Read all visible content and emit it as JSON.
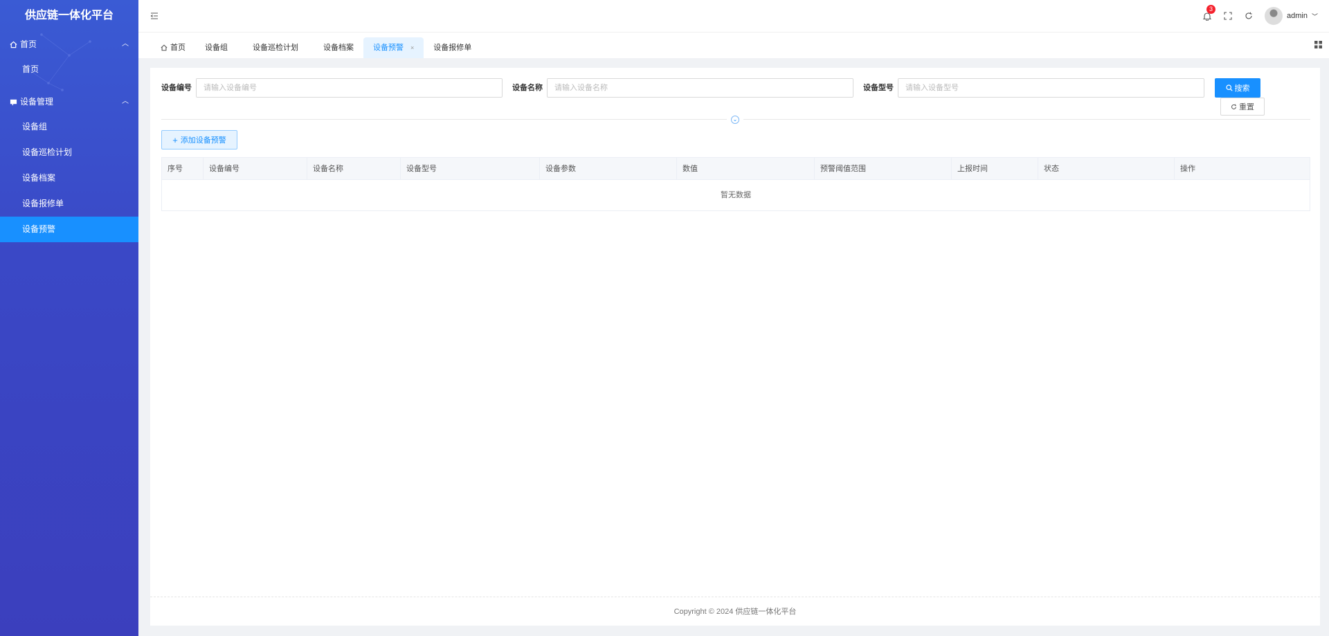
{
  "app": {
    "title": "供应链一体化平台"
  },
  "sidebar": {
    "groups": [
      {
        "label": "首页",
        "items": [
          {
            "label": "首页"
          }
        ]
      },
      {
        "label": "设备管理",
        "items": [
          {
            "label": "设备组"
          },
          {
            "label": "设备巡检计划"
          },
          {
            "label": "设备档案"
          },
          {
            "label": "设备报修单"
          },
          {
            "label": "设备预警",
            "active": true
          }
        ]
      }
    ]
  },
  "header": {
    "notification_count": "3",
    "username": "admin"
  },
  "tabs": [
    {
      "label": "首页"
    },
    {
      "label": "设备组"
    },
    {
      "label": "设备巡检计划"
    },
    {
      "label": "设备档案"
    },
    {
      "label": "设备预警",
      "active": true,
      "close": "×"
    },
    {
      "label": "设备报修单"
    }
  ],
  "filters": {
    "code_label": "设备编号",
    "code_placeholder": "请输入设备编号",
    "name_label": "设备名称",
    "name_placeholder": "请输入设备名称",
    "model_label": "设备型号",
    "model_placeholder": "请输入设备型号",
    "search_label": "搜索",
    "reset_label": "重置"
  },
  "actions": {
    "add_label": "添加设备预警"
  },
  "table": {
    "columns": [
      "序号",
      "设备编号",
      "设备名称",
      "设备型号",
      "设备参数",
      "数值",
      "预警阈值范围",
      "上报时间",
      "状态",
      "操作"
    ],
    "empty_text": "暂无数据"
  },
  "footer": {
    "text": "Copyright © 2024 供应链一体化平台"
  },
  "colors": {
    "primary": "#1890ff",
    "sidebar": "#3a48c6"
  }
}
